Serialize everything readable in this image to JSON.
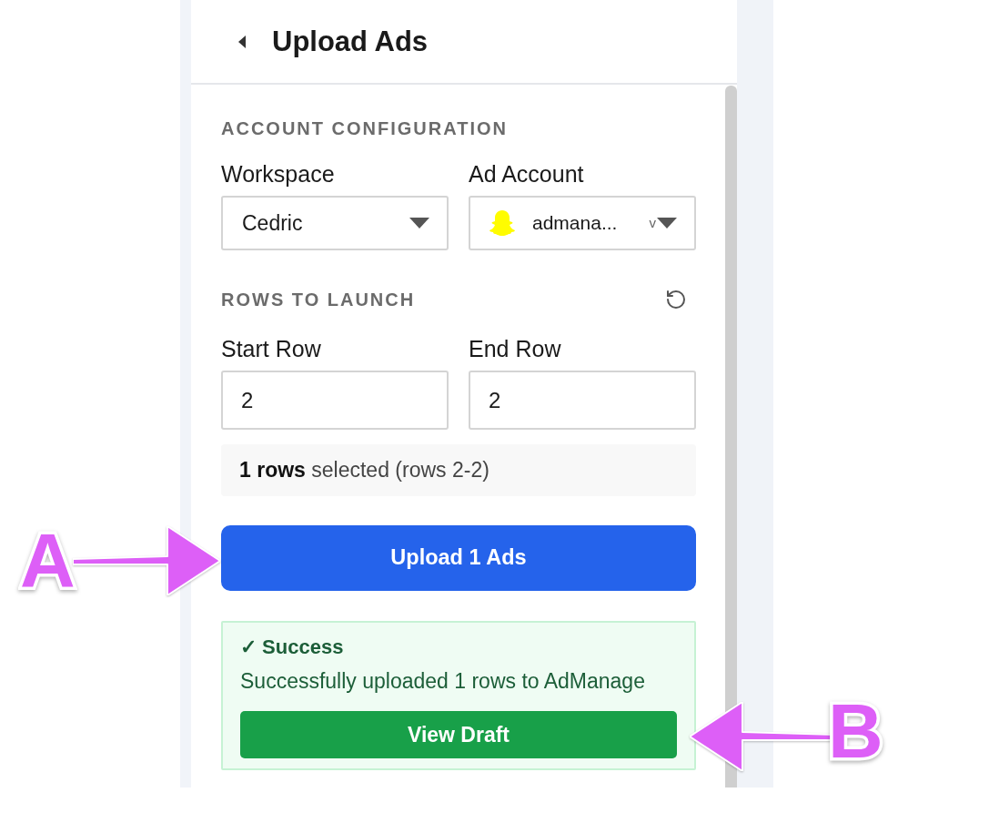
{
  "header": {
    "title": "Upload Ads"
  },
  "account_configuration": {
    "heading": "ACCOUNT CONFIGURATION",
    "workspace": {
      "label": "Workspace",
      "value": "Cedric"
    },
    "ad_account": {
      "label": "Ad Account",
      "value": "admana...",
      "suffix": "v"
    }
  },
  "rows_to_launch": {
    "heading": "ROWS TO LAUNCH",
    "start_row": {
      "label": "Start Row",
      "value": "2"
    },
    "end_row": {
      "label": "End Row",
      "value": "2"
    },
    "summary": "**1 rows** selected (rows 2-2)"
  },
  "upload_button": {
    "label": "Upload 1 Ads",
    "annotation": {
      "letter": "A",
      "kind": "rightward"
    }
  },
  "success": {
    "title": "✓ Success",
    "message": "Successfully uploaded 1 rows to AdManage",
    "button": {
      "label": "View Draft",
      "annotation": {
        "letter": "B",
        "kind": "leftward"
      }
    }
  }
}
